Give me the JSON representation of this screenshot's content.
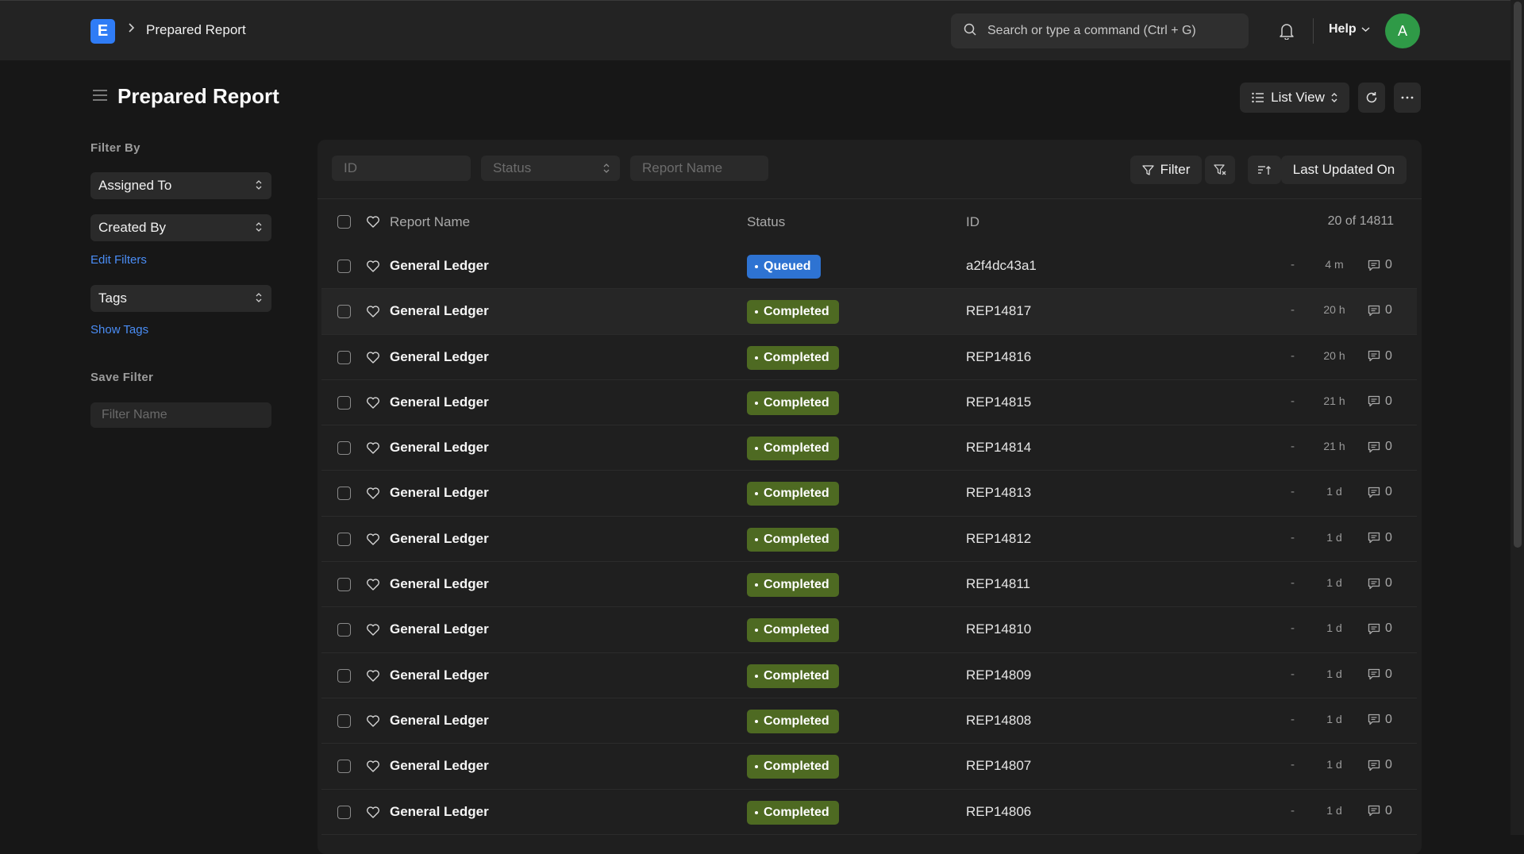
{
  "navbar": {
    "logo_letter": "E",
    "breadcrumb": "Prepared Report",
    "search_placeholder": "Search or type a command (Ctrl + G)",
    "help_label": "Help",
    "avatar_letter": "A"
  },
  "page": {
    "title": "Prepared Report",
    "view_label": "List View"
  },
  "sidebar": {
    "filter_by_label": "Filter By",
    "assigned_to": "Assigned To",
    "created_by": "Created By",
    "edit_filters": "Edit Filters",
    "tags": "Tags",
    "show_tags": "Show Tags",
    "save_filter_label": "Save Filter",
    "filter_name_placeholder": "Filter Name"
  },
  "filters": {
    "id_placeholder": "ID",
    "status_placeholder": "Status",
    "report_name_placeholder": "Report Name",
    "filter_label": "Filter",
    "sort_label": "Last Updated On"
  },
  "table": {
    "columns": {
      "report_name": "Report Name",
      "status": "Status",
      "id": "ID"
    },
    "count": "20 of 14811",
    "rows": [
      {
        "name": "General Ledger",
        "status": "Queued",
        "id": "a2f4dc43a1",
        "dash": "-",
        "time": "4 m",
        "comments": "0"
      },
      {
        "name": "General Ledger",
        "status": "Completed",
        "id": "REP14817",
        "dash": "-",
        "time": "20 h",
        "comments": "0"
      },
      {
        "name": "General Ledger",
        "status": "Completed",
        "id": "REP14816",
        "dash": "-",
        "time": "20 h",
        "comments": "0"
      },
      {
        "name": "General Ledger",
        "status": "Completed",
        "id": "REP14815",
        "dash": "-",
        "time": "21 h",
        "comments": "0"
      },
      {
        "name": "General Ledger",
        "status": "Completed",
        "id": "REP14814",
        "dash": "-",
        "time": "21 h",
        "comments": "0"
      },
      {
        "name": "General Ledger",
        "status": "Completed",
        "id": "REP14813",
        "dash": "-",
        "time": "1 d",
        "comments": "0"
      },
      {
        "name": "General Ledger",
        "status": "Completed",
        "id": "REP14812",
        "dash": "-",
        "time": "1 d",
        "comments": "0"
      },
      {
        "name": "General Ledger",
        "status": "Completed",
        "id": "REP14811",
        "dash": "-",
        "time": "1 d",
        "comments": "0"
      },
      {
        "name": "General Ledger",
        "status": "Completed",
        "id": "REP14810",
        "dash": "-",
        "time": "1 d",
        "comments": "0"
      },
      {
        "name": "General Ledger",
        "status": "Completed",
        "id": "REP14809",
        "dash": "-",
        "time": "1 d",
        "comments": "0"
      },
      {
        "name": "General Ledger",
        "status": "Completed",
        "id": "REP14808",
        "dash": "-",
        "time": "1 d",
        "comments": "0"
      },
      {
        "name": "General Ledger",
        "status": "Completed",
        "id": "REP14807",
        "dash": "-",
        "time": "1 d",
        "comments": "0"
      },
      {
        "name": "General Ledger",
        "status": "Completed",
        "id": "REP14806",
        "dash": "-",
        "time": "1 d",
        "comments": "0"
      }
    ]
  },
  "colors": {
    "queued": "#2e73d2",
    "completed": "#4e6a22",
    "accent": "#2f7cf6",
    "avatar": "#2f9a47"
  }
}
